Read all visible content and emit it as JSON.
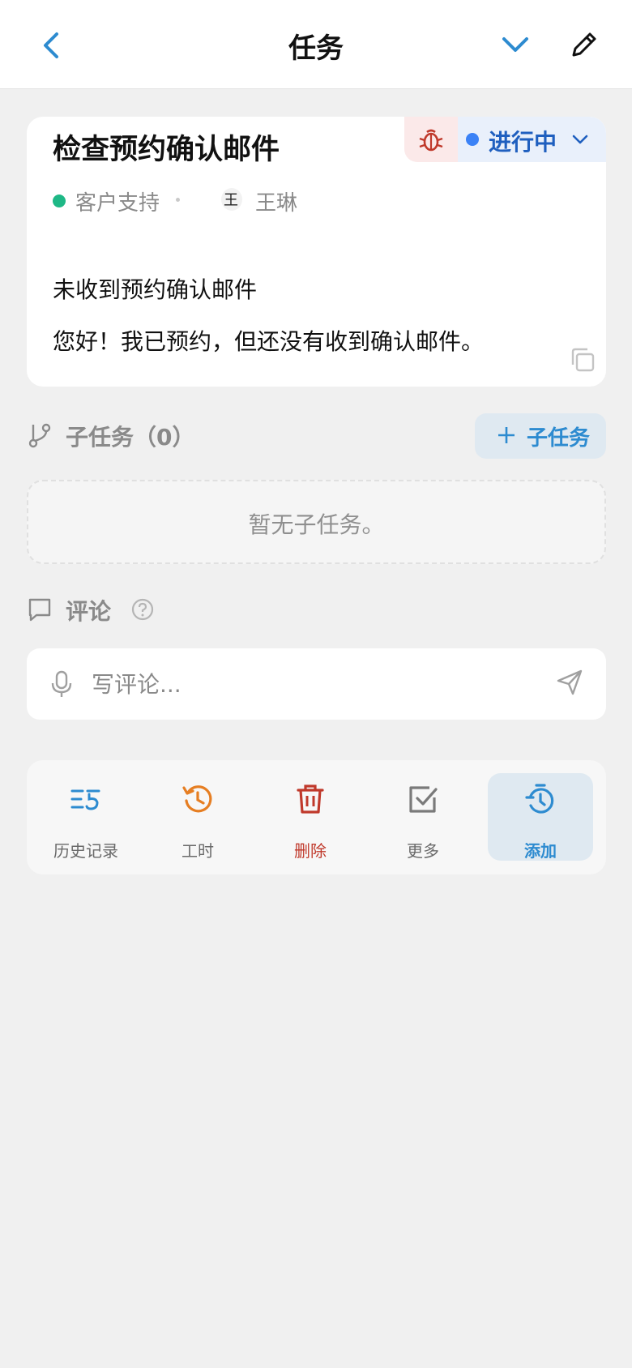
{
  "header": {
    "title": "任务"
  },
  "task": {
    "title": "检查预约确认邮件",
    "status": "进行中",
    "category": "客户支持",
    "assignee": "王琳",
    "avatar_initial": "王",
    "subject": "未收到预约确认邮件",
    "body": "您好！我已预约，但还没有收到确认邮件。"
  },
  "subtasks": {
    "heading": "子任务（0）",
    "add_label": "子任务",
    "empty_text": "暂无子任务。"
  },
  "comments": {
    "heading": "评论",
    "placeholder": "写评论..."
  },
  "actions": [
    {
      "label": "历史记录",
      "icon": "history-list-icon",
      "color": "#6a6a6a"
    },
    {
      "label": "工时",
      "icon": "clock-history-icon",
      "color": "#6a6a6a"
    },
    {
      "label": "删除",
      "icon": "trash-icon",
      "color": "#c0392b"
    },
    {
      "label": "更多",
      "icon": "checkbox-icon",
      "color": "#6a6a6a"
    },
    {
      "label": "添加",
      "icon": "timer-icon",
      "color": "#2d8bd0"
    }
  ],
  "colors": {
    "accent": "#2d8bd0",
    "status_blue": "#3b82f6",
    "category_green": "#1eb886",
    "danger": "#c0392b",
    "clock_orange": "#e67e22"
  }
}
